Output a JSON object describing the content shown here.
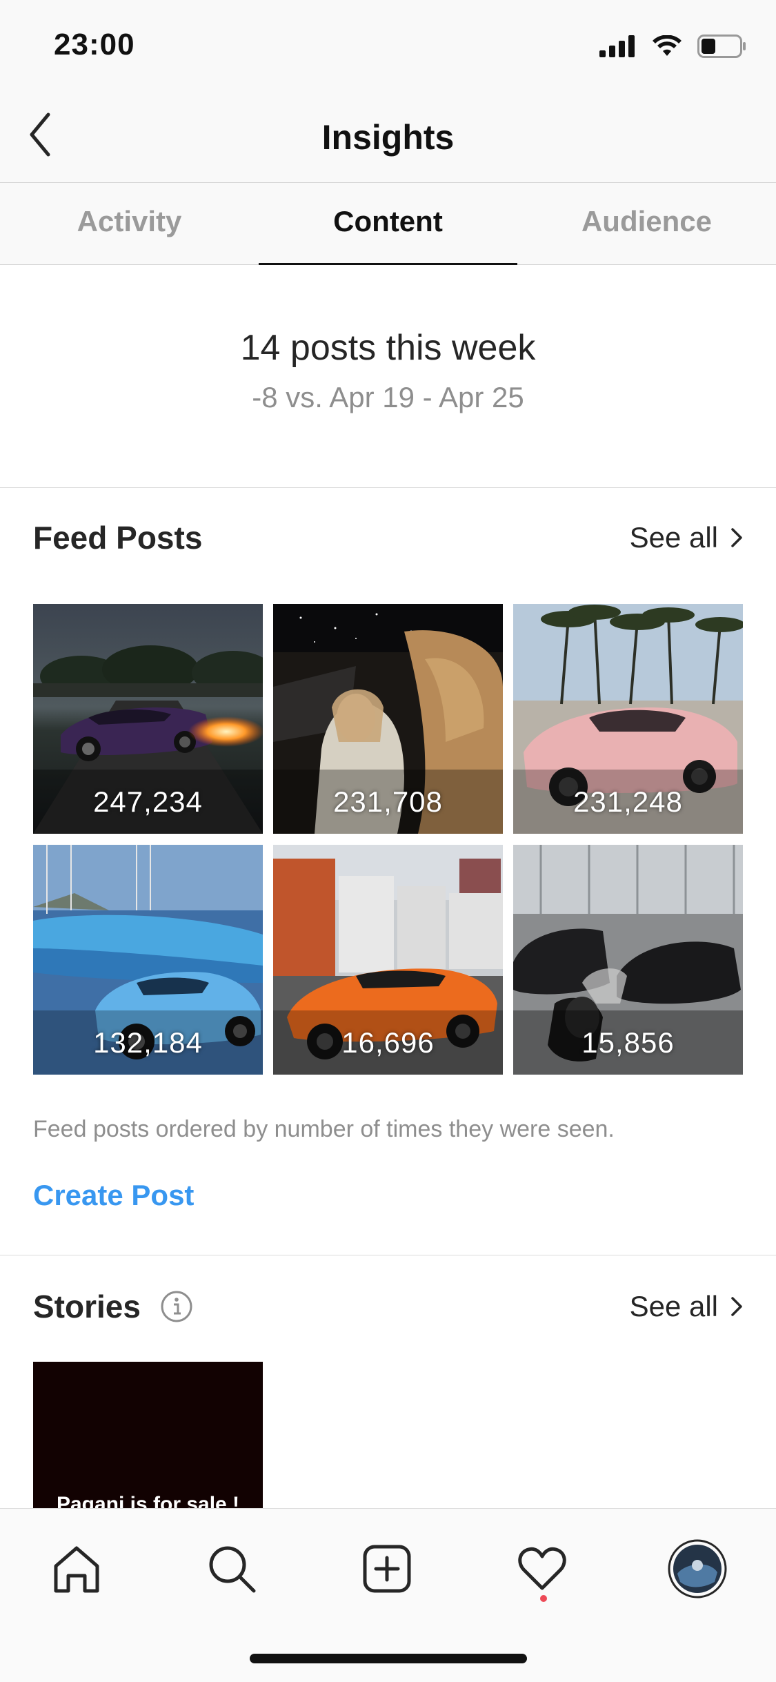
{
  "status_bar": {
    "time": "23:00"
  },
  "header": {
    "title": "Insights"
  },
  "tabs": [
    {
      "label": "Activity",
      "active": false
    },
    {
      "label": "Content",
      "active": true
    },
    {
      "label": "Audience",
      "active": false
    }
  ],
  "summary": {
    "headline": "14 posts this week",
    "comparison": "-8 vs. Apr 19 - Apr 25"
  },
  "feed_posts": {
    "title": "Feed Posts",
    "see_all": "See all",
    "posts": [
      {
        "count": "247,234"
      },
      {
        "count": "231,708"
      },
      {
        "count": "231,248"
      },
      {
        "count": "132,184"
      },
      {
        "count": "16,696"
      },
      {
        "count": "15,856"
      }
    ],
    "note": "Feed posts ordered by number of times they were seen.",
    "create_label": "Create Post"
  },
  "stories": {
    "title": "Stories",
    "see_all": "See all",
    "first_story_text": "Pagani is for sale !"
  },
  "bottom_nav": [
    "home-icon",
    "search-icon",
    "new-post-icon",
    "activity-heart-icon",
    "profile-avatar"
  ],
  "colors": {
    "accent": "#3897f0",
    "notification": "#ed4956"
  }
}
